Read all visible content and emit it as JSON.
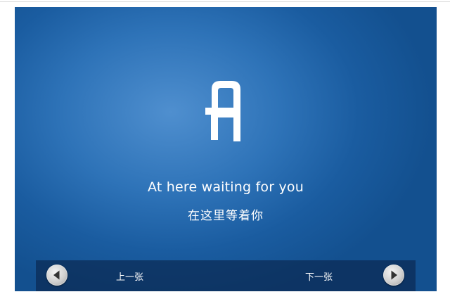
{
  "slide": {
    "logo_glyph": "A",
    "caption_en": "At here waiting for you",
    "caption_zh": "在这里等着你"
  },
  "navigation": {
    "prev_icon": "arrow-left-icon",
    "prev_label": "上一张",
    "next_label": "下一张",
    "next_icon": "arrow-right-icon"
  },
  "colors": {
    "slide_background": "#2e73b8",
    "nav_bar_background": "#0a2850",
    "text": "#ffffff"
  }
}
